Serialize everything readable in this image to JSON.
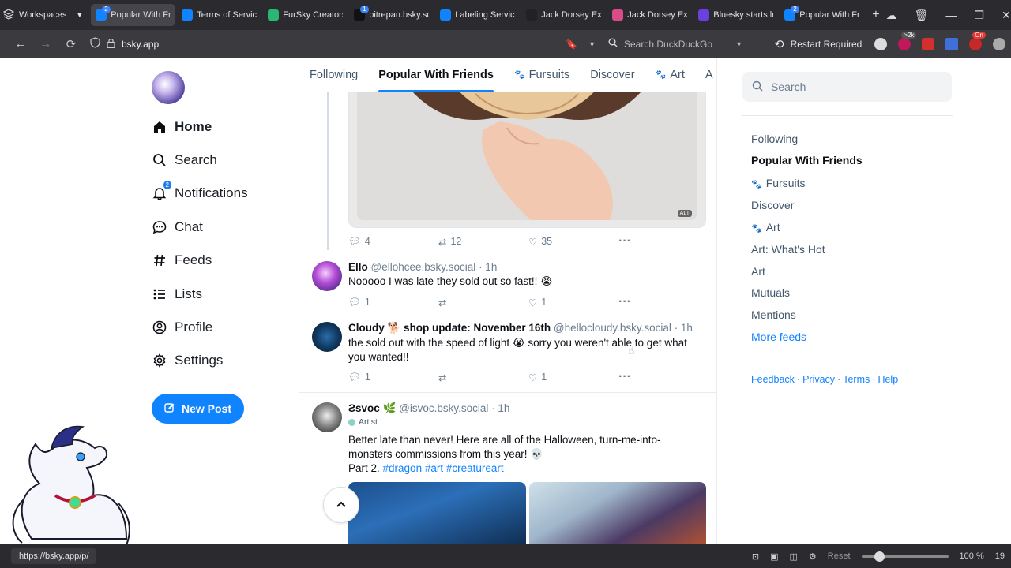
{
  "browser": {
    "workspaces_label": "Workspaces",
    "tabs": [
      {
        "label": "Popular With Fr",
        "badge": "2",
        "color": "#1083fe",
        "active": true
      },
      {
        "label": "Terms of Service",
        "badge": "",
        "color": "#1083fe",
        "active": false
      },
      {
        "label": "FurSky Creators",
        "badge": "",
        "color": "#2bb673",
        "active": false
      },
      {
        "label": "pitrepan.bsky.so",
        "badge": "1",
        "color": "#111111",
        "active": false
      },
      {
        "label": "Labeling Service",
        "badge": "",
        "color": "#1083fe",
        "active": false
      },
      {
        "label": "Jack Dorsey Exit",
        "badge": "",
        "color": "#222222",
        "active": false
      },
      {
        "label": "Jack Dorsey Exp",
        "badge": "",
        "color": "#d94c8a",
        "active": false
      },
      {
        "label": "Bluesky starts le",
        "badge": "",
        "color": "#6c3fe0",
        "active": false
      },
      {
        "label": "Popular With Fri",
        "badge": "2",
        "color": "#1083fe",
        "active": false
      }
    ],
    "url": "bsky.app",
    "search_placeholder": "Search DuckDuckGo",
    "restart_label": "Restart Required",
    "ext_badge_1": ">2k",
    "ext_badge_2": "On",
    "status_url": "https://bsky.app/p/",
    "zoom_reset": "Reset",
    "zoom_level": "100 %",
    "zoom_fraction": 0.2,
    "status_trailing": "19"
  },
  "nav": {
    "items": [
      {
        "label": "Home",
        "icon": "home-icon"
      },
      {
        "label": "Search",
        "icon": "search-icon"
      },
      {
        "label": "Notifications",
        "icon": "bell-icon",
        "badge": "2"
      },
      {
        "label": "Chat",
        "icon": "chat-icon"
      },
      {
        "label": "Feeds",
        "icon": "hash-icon"
      },
      {
        "label": "Lists",
        "icon": "list-icon"
      },
      {
        "label": "Profile",
        "icon": "profile-icon"
      },
      {
        "label": "Settings",
        "icon": "gear-icon"
      }
    ],
    "new_post_label": "New Post"
  },
  "feed_tabs": [
    {
      "label": "Following",
      "paw": false
    },
    {
      "label": "Popular With Friends",
      "paw": false,
      "active": true
    },
    {
      "label": "Fursuits",
      "paw": true
    },
    {
      "label": "Discover",
      "paw": false
    },
    {
      "label": "Art",
      "paw": true
    },
    {
      "label": "A",
      "paw": false
    }
  ],
  "posts": {
    "top": {
      "alt": "ALT",
      "replies": "4",
      "reposts": "12",
      "likes": "35"
    },
    "ello": {
      "name": "Ello",
      "handle": "@ellohcee.bsky.social",
      "time": "· 1h",
      "text": "Nooooo I was late they sold out so fast!! 😭",
      "replies": "1",
      "likes": "1"
    },
    "cloudy": {
      "name": "Cloudy 🐕 shop update: November 16th",
      "handle": "@hellocloudy.bsky.social",
      "time": "· 1h",
      "text": "the sold out with the speed of light 😭 sorry you weren't able to get what you wanted!!",
      "replies": "1",
      "likes": "1"
    },
    "isvoc": {
      "name": "Ƨsvoc 🌿",
      "handle": "@isvoc.bsky.social",
      "time": "· 1h",
      "label": "Artist",
      "text": "Better late than never! Here are all of the Halloween, turn-me-into-monsters commissions from this year! 💀",
      "text2_prefix": "Part 2. ",
      "tags": [
        "#dragon",
        "#art",
        "#creatureart"
      ]
    }
  },
  "right": {
    "search_placeholder": "Search",
    "feeds": [
      {
        "label": "Following",
        "paw": false
      },
      {
        "label": "Popular With Friends",
        "paw": false,
        "active": true
      },
      {
        "label": "Fursuits",
        "paw": true
      },
      {
        "label": "Discover",
        "paw": false
      },
      {
        "label": "Art",
        "paw": true
      },
      {
        "label": "Art: What's Hot",
        "paw": false
      },
      {
        "label": "Art",
        "paw": false
      },
      {
        "label": "Mutuals",
        "paw": false
      },
      {
        "label": "Mentions",
        "paw": false
      },
      {
        "label": "More feeds",
        "paw": false,
        "link": true
      }
    ],
    "footer": [
      "Feedback",
      "Privacy",
      "Terms",
      "Help"
    ]
  },
  "colors": {
    "accent": "#1083fe",
    "chrome": "#2b2b2f"
  }
}
